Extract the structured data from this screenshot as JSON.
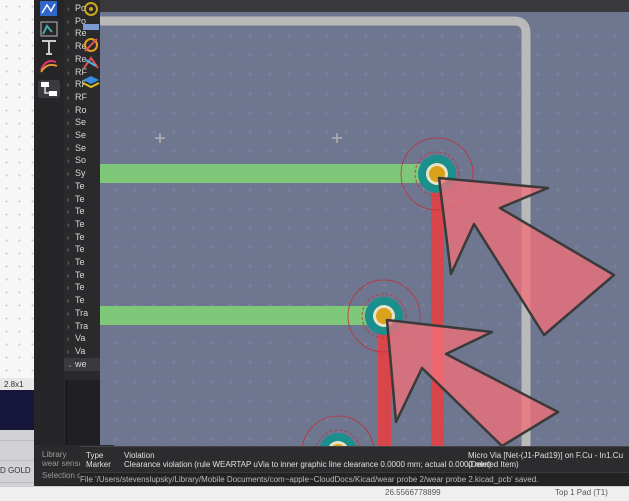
{
  "background_app": {
    "label_1": "2.8x1",
    "label_2": "D GOLD"
  },
  "tree": {
    "items": [
      {
        "label": "Po",
        "expand": "›"
      },
      {
        "label": "Po",
        "expand": "›"
      },
      {
        "label": "Re",
        "expand": "›"
      },
      {
        "label": "Re",
        "expand": "›"
      },
      {
        "label": "Re",
        "expand": "›"
      },
      {
        "label": "RF",
        "expand": "›"
      },
      {
        "label": "RF",
        "expand": "›"
      },
      {
        "label": "RF",
        "expand": "›"
      },
      {
        "label": "Ro",
        "expand": "›"
      },
      {
        "label": "Se",
        "expand": "›"
      },
      {
        "label": "Se",
        "expand": "›"
      },
      {
        "label": "Se",
        "expand": "›"
      },
      {
        "label": "So",
        "expand": "›"
      },
      {
        "label": "Sy",
        "expand": "›"
      },
      {
        "label": "Te",
        "expand": "›"
      },
      {
        "label": "Te",
        "expand": "›"
      },
      {
        "label": "Te",
        "expand": "›"
      },
      {
        "label": "Te",
        "expand": "›"
      },
      {
        "label": "Te",
        "expand": "›"
      },
      {
        "label": "Te",
        "expand": "›"
      },
      {
        "label": "Te",
        "expand": "›"
      },
      {
        "label": "Te",
        "expand": "›"
      },
      {
        "label": "Te",
        "expand": "›"
      },
      {
        "label": "Te",
        "expand": "›"
      },
      {
        "label": "Tra",
        "expand": "›"
      },
      {
        "label": "Tra",
        "expand": "›"
      },
      {
        "label": "Va",
        "expand": "›"
      },
      {
        "label": "Va",
        "expand": "›"
      },
      {
        "label": "we",
        "expand": "⌄"
      }
    ]
  },
  "library_panel": {
    "title": "Library",
    "item": "wear sensor",
    "footer": "Selection co"
  },
  "message_panel": {
    "type_header": "Type",
    "type_value": "Marker",
    "violation_header": "Violation",
    "violation_text": "Clearance violation (rule WEARTAP uVia to inner graphic line clearance 0.0000 mm; actual 0.0000 mm)",
    "item_text": "Micro Via [Net-(J1-Pad19)] on F.Cu - In1.Cu",
    "item_status": "(Deleted Item)"
  },
  "status_bar": {
    "saved_message": "File '/Users/stevenslupsky/Library/Mobile Documents/com~apple~CloudDocs/Kicad/wear probe 2/wear probe 2.kicad_pcb' saved."
  },
  "bottom_strip": {
    "left_text": "26.5566778899",
    "right_text": "Top 1 Pad (T1)"
  },
  "colors": {
    "canvas_bg": "#08102a",
    "board_edge": "#b9b9b9",
    "trace_green": "#7fc87a",
    "trace_red": "#d8454a",
    "via_teal": "#1a8f8c",
    "via_gold": "#d9a21a",
    "marker_pink": "#f0707a"
  }
}
